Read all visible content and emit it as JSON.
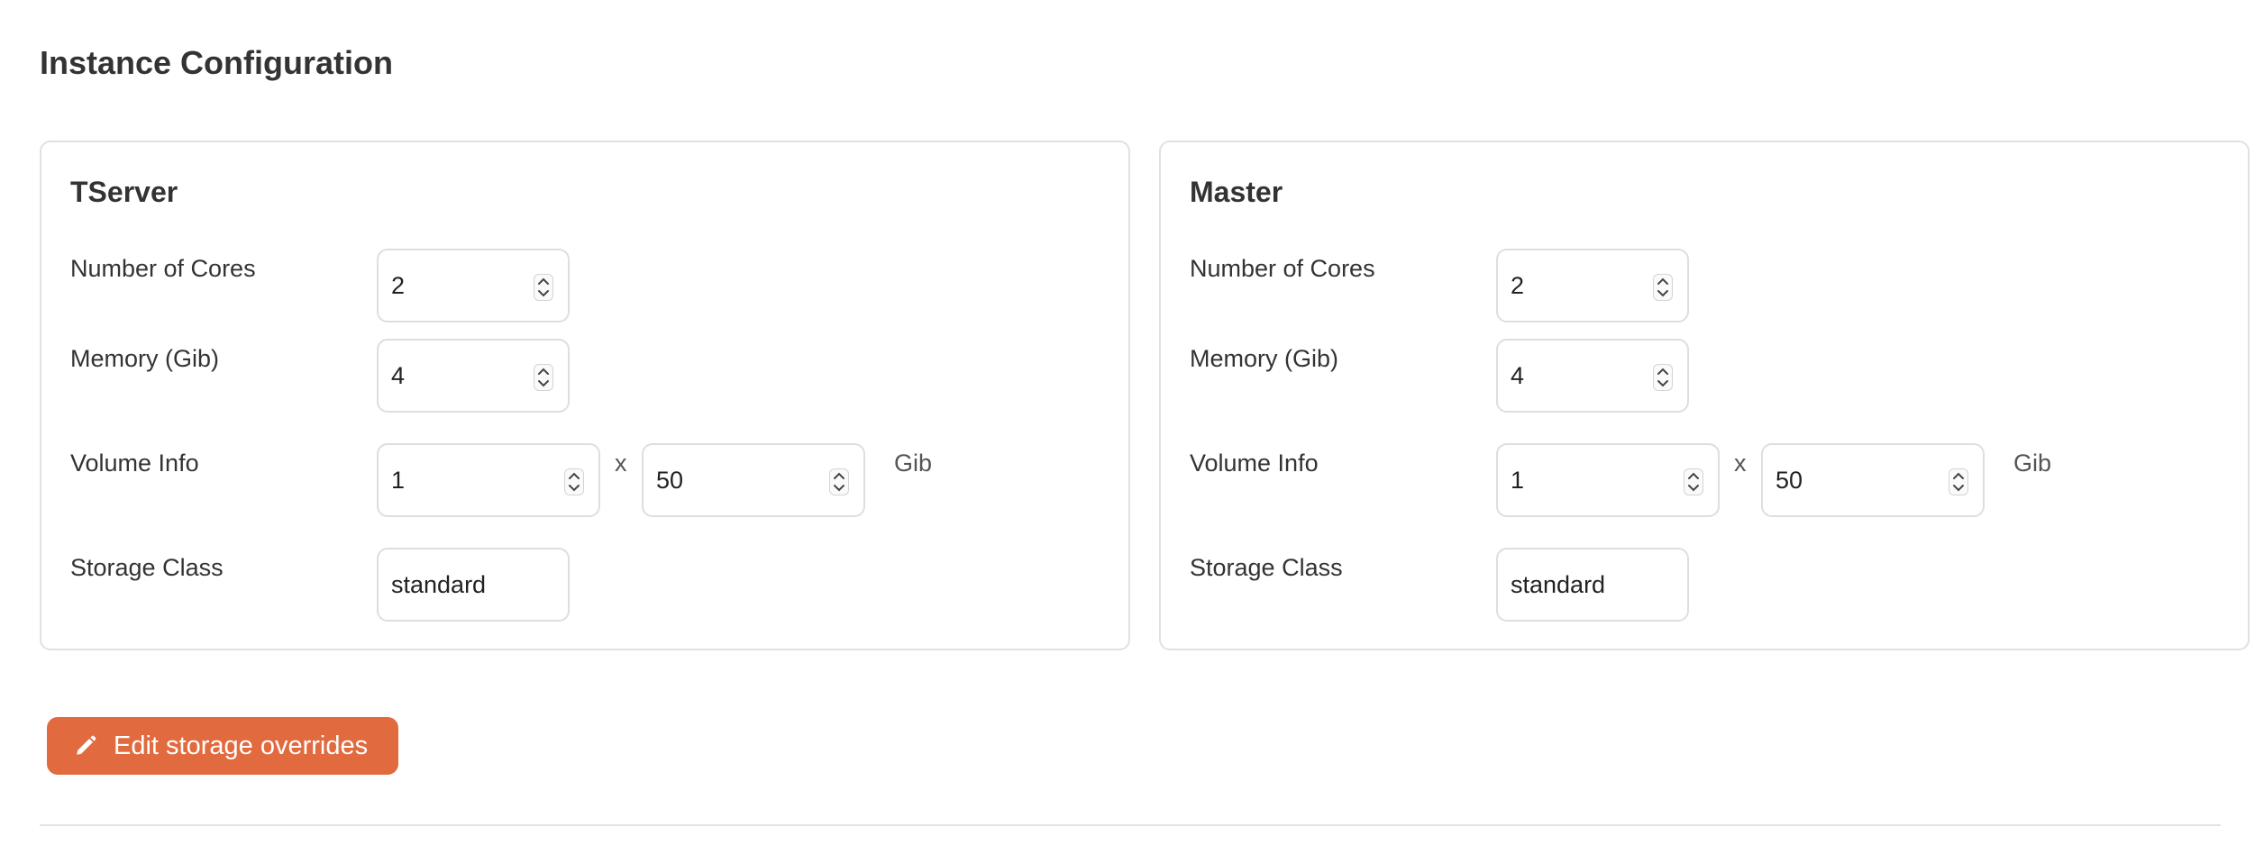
{
  "page": {
    "title": "Instance Configuration"
  },
  "tserver": {
    "title": "TServer",
    "cores_label": "Number of Cores",
    "cores_value": "2",
    "memory_label": "Memory (Gib)",
    "memory_value": "4",
    "volume_label": "Volume Info",
    "volume_count": "1",
    "volume_times": "x",
    "volume_size": "50",
    "volume_unit": "Gib",
    "storage_label": "Storage Class",
    "storage_value": "standard"
  },
  "master": {
    "title": "Master",
    "cores_label": "Number of Cores",
    "cores_value": "2",
    "memory_label": "Memory (Gib)",
    "memory_value": "4",
    "volume_label": "Volume Info",
    "volume_count": "1",
    "volume_times": "x",
    "volume_size": "50",
    "volume_unit": "Gib",
    "storage_label": "Storage Class",
    "storage_value": "standard"
  },
  "actions": {
    "edit_storage_label": "Edit storage overrides",
    "edit_storage_icon": "pencil-icon"
  },
  "theme": {
    "accent": "#e16a3e",
    "border": "#e1e1e1",
    "text": "#333333"
  }
}
